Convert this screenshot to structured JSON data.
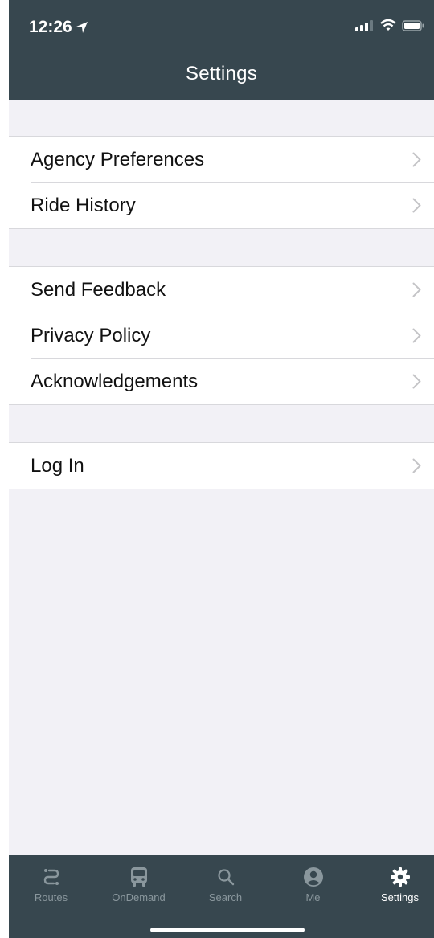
{
  "status_bar": {
    "time": "12:26"
  },
  "header": {
    "title": "Settings"
  },
  "groups": [
    {
      "items": [
        "Agency Preferences",
        "Ride History"
      ]
    },
    {
      "items": [
        "Send Feedback",
        "Privacy Policy",
        "Acknowledgements"
      ]
    },
    {
      "items": [
        "Log In"
      ]
    }
  ],
  "tabbar": {
    "tabs": [
      {
        "label": "Routes",
        "icon": "routes-icon"
      },
      {
        "label": "OnDemand",
        "icon": "bus-icon"
      },
      {
        "label": "Search",
        "icon": "search-icon"
      },
      {
        "label": "Me",
        "icon": "person-icon"
      },
      {
        "label": "Settings",
        "icon": "gear-icon",
        "active": true
      }
    ]
  },
  "colors": {
    "header_bg": "#37474f",
    "background": "#f2f1f6",
    "inactive_tab": "#8a979d",
    "active_tab": "#ffffff"
  }
}
